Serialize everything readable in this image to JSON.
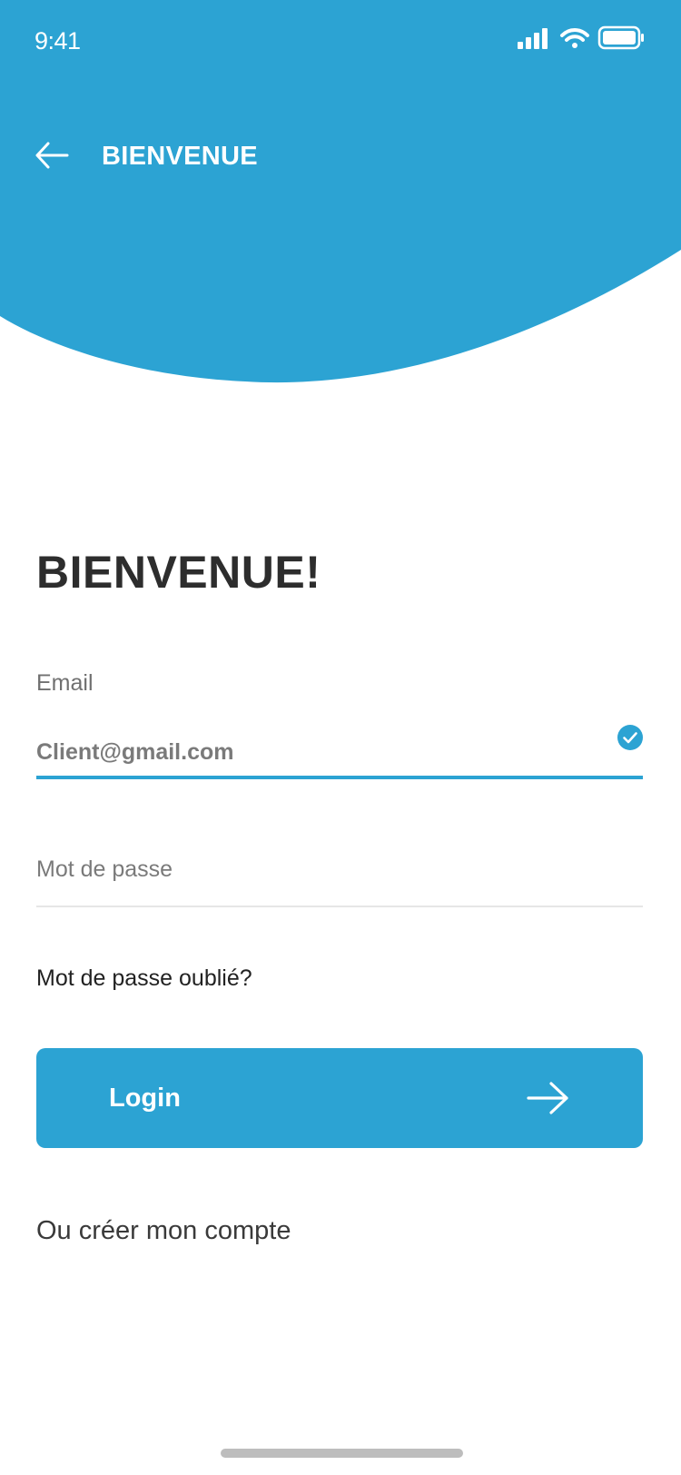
{
  "status_bar": {
    "time": "9:41",
    "icons": [
      "signal-icon",
      "wifi-icon",
      "battery-icon"
    ]
  },
  "header": {
    "title": "BIENVENUE",
    "back_icon": "arrow-left-icon"
  },
  "main": {
    "heading": "BIENVENUE!",
    "email": {
      "label": "Email",
      "value": "Client@gmail.com",
      "valid_icon": "check-circle-icon"
    },
    "password": {
      "placeholder": "Mot de passe",
      "value": ""
    },
    "forgot_password": "Mot de passe oublié?",
    "login_button": {
      "label": "Login",
      "icon": "arrow-right-icon"
    },
    "create_account": "Ou créer mon compte"
  },
  "colors": {
    "accent": "#2ca3d3",
    "heading": "#2d2d2d",
    "muted_text": "#707070",
    "divider": "#e6e6e6",
    "background": "#ffffff"
  }
}
